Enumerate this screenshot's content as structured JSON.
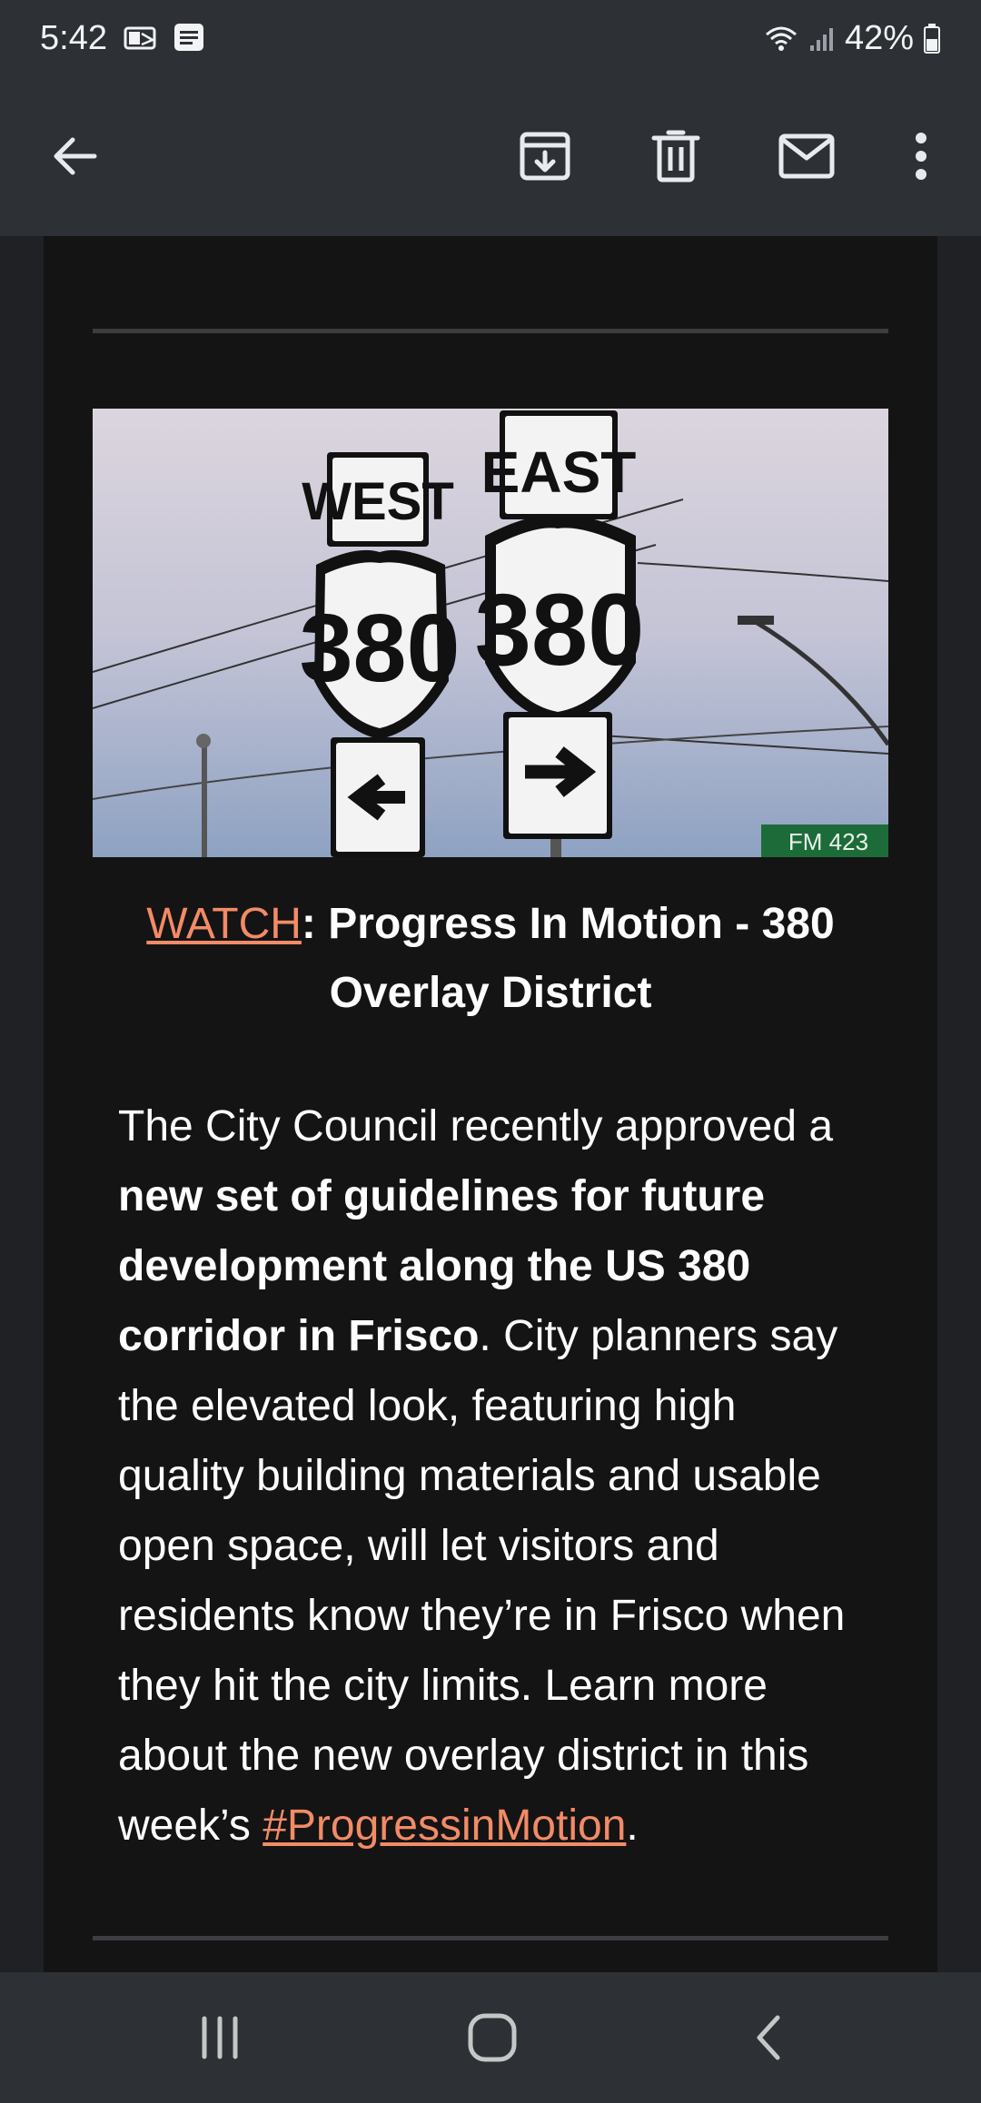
{
  "status_bar": {
    "time": "5:42",
    "left_icons": [
      "outlook-notification-icon",
      "message-notification-icon"
    ],
    "right_icons": [
      "wifi-icon",
      "signal-icon",
      "battery-icon"
    ],
    "battery_percent": "42%"
  },
  "app_bar": {
    "actions": [
      "back-arrow-icon",
      "archive-icon",
      "delete-icon",
      "mark-unread-icon",
      "more-options-icon"
    ]
  },
  "email": {
    "image_alt_icons": [
      "west-sign",
      "east-sign"
    ],
    "hero_signs": {
      "west_label": "WEST",
      "east_label": "EAST",
      "route_number": "380",
      "street_sign": "FM 423"
    },
    "caption": {
      "link_text": "WATCH",
      "title_text": ": Progress In Motion - 380 Overlay District"
    },
    "body": {
      "part1": "The City Council recently approved a ",
      "bold": "new set of guidelines for future development along the US 380 corridor in Frisco",
      "part2": ". City planners say the elevated look, featuring high quality building materials and usable open space, will let visitors and residents know they’re in Frisco when they hit the city limits. Learn more about the new overlay district in this week’s ",
      "link_text": "#ProgressinMotion",
      "part3": "."
    }
  },
  "nav_bar": {
    "buttons": [
      "recent-apps-icon",
      "home-icon",
      "back-icon"
    ]
  },
  "colors": {
    "link": "#f28b66",
    "bar_background": "#2d3035",
    "card_background": "#141414"
  }
}
